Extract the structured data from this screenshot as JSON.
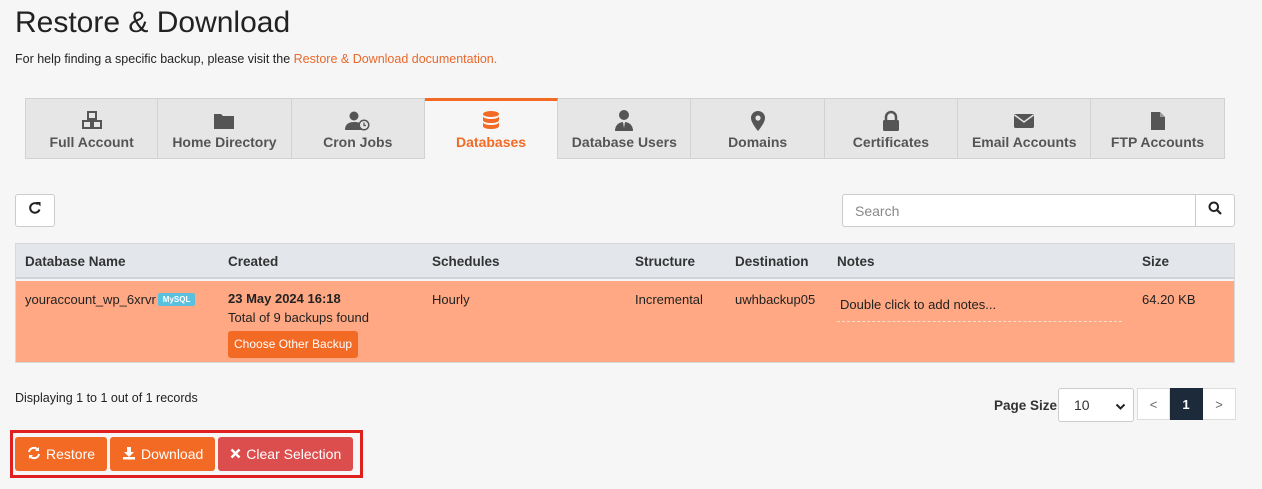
{
  "page": {
    "title": "Restore & Download",
    "help_prefix": "For help finding a specific backup, please visit the",
    "help_link": "Restore & Download documentation."
  },
  "tabs": [
    {
      "label": "Full Account",
      "icon": "cubes-icon"
    },
    {
      "label": "Home Directory",
      "icon": "folder-icon"
    },
    {
      "label": "Cron Jobs",
      "icon": "user-clock-icon"
    },
    {
      "label": "Databases",
      "icon": "database-icon",
      "active": true
    },
    {
      "label": "Database Users",
      "icon": "user-tie-icon"
    },
    {
      "label": "Domains",
      "icon": "map-marker-icon"
    },
    {
      "label": "Certificates",
      "icon": "lock-icon"
    },
    {
      "label": "Email Accounts",
      "icon": "envelope-icon"
    },
    {
      "label": "FTP Accounts",
      "icon": "file-icon"
    }
  ],
  "search": {
    "placeholder": "Search"
  },
  "table": {
    "headers": [
      "Database Name",
      "Created",
      "Schedules",
      "Structure",
      "Destination",
      "Notes",
      "Size"
    ],
    "rows": [
      {
        "name": "youraccount_wp_6xrvr",
        "badge": "MySQL",
        "created": "23 May 2024 16:18",
        "backups_found": "Total of 9 backups found",
        "choose_button": "Choose Other Backup",
        "schedule": "Hourly",
        "structure": "Incremental",
        "destination": "uwhbackup05",
        "notes": "Double click to add notes...",
        "size": "64.20 KB"
      }
    ]
  },
  "footer": {
    "records": "Displaying 1 to 1 out of 1 records",
    "page_size_label": "Page Size",
    "page_size": "10",
    "prev": "<",
    "current_page": "1",
    "next": ">"
  },
  "actions": {
    "restore": "Restore",
    "download": "Download",
    "clear": "Clear Selection"
  },
  "colors": {
    "accent": "#f26a24",
    "row_selected": "#ffa883",
    "danger": "#dc4e4e",
    "highlight_box": "#e0201f"
  }
}
